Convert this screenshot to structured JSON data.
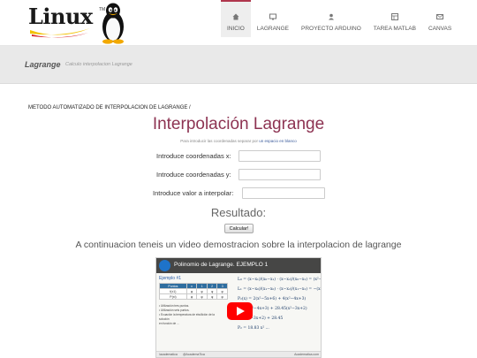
{
  "logo": {
    "text": "Linux",
    "tm": "TM"
  },
  "nav": [
    {
      "label": "INICIO",
      "icon": "home-icon",
      "active": true
    },
    {
      "label": "LAGRANGE",
      "icon": "screen-icon",
      "active": false
    },
    {
      "label": "PROYECTO ARDUINO",
      "icon": "user-icon",
      "active": false
    },
    {
      "label": "TAREA MATLAB",
      "icon": "grid-icon",
      "active": false
    },
    {
      "label": "CANVAS",
      "icon": "mail-icon",
      "active": false
    }
  ],
  "banner": {
    "title": "Lagrange",
    "subtitle": "Calculo interpolacion Lagrange"
  },
  "section_path": "METODO AUTOMATIZADO DE INTERPOLACION DE LAGRANGE /",
  "main": {
    "title": "Interpolación Lagrange",
    "hint_pre": "Para introducir las coordenadas separar por",
    "hint_link": "un espacio en blanco",
    "x_label": "Introduce coordenadas x:",
    "x_value": "",
    "y_label": "Introduce coordenadas y:",
    "y_value": "",
    "interp_label": "Introduce valor a interpolar:",
    "interp_value": "",
    "result_title": "Resultado:",
    "calc_button": "Calcular!",
    "video_caption": "A continuacion teneis un video demostracion sobre la interpolacion de lagrange"
  },
  "video": {
    "title": "Polinomio de Lagrange. EJEMPLO 1",
    "subtitle": "Ejemplo #1",
    "table": [
      [
        "Puntos",
        "x",
        "1",
        "2",
        "3"
      ],
      [
        "f(x1)",
        "φ",
        "φ",
        "φ",
        "φ"
      ],
      [
        "P(xi)",
        "φ",
        "φ",
        "φ",
        "φ"
      ]
    ],
    "bullets": [
      "• Utilización tres puntos.",
      "• Utilización seis puntos.",
      "• Ecuación la temperatura de ebullición de la solución",
      "  en función de ..."
    ],
    "formulas": [
      "L₀ = (x−x₁)/(x₀−x₁) · (x−x₂)/(x₀−x₂) = (x²−5x+6)/2",
      "L₁ = (x−x₀)/(x₁−x₀) · (x−x₂)/(x₁−x₂) = −(x²−4x+3)",
      "P₂(x) = 2(x²−5x+6) + 4(x²−4x+3)",
      "= −4(x²−4x+3) + 28.45(x²−3x+2)",
      "= 2(x²−3x+2) + 28.45",
      "P₂ = 18.83 x² ..."
    ],
    "bottom_left": "/academatica",
    "bottom_mid": "@AcademaTica",
    "bottom_right": "Academatica.com",
    "play_color": "#ff0000"
  },
  "colors": {
    "accent": "#b0364d",
    "title": "#8d3352"
  }
}
